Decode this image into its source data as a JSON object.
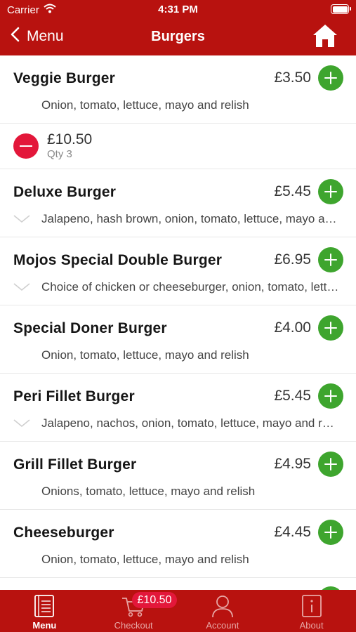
{
  "status_bar": {
    "carrier": "Carrier",
    "time": "4:31 PM"
  },
  "nav": {
    "back_label": "Menu",
    "title": "Burgers"
  },
  "items": [
    {
      "name": "Veggie Burger",
      "price": "£3.50",
      "description": "Onion, tomato, lettuce, mayo and relish"
    },
    {
      "name": "Deluxe Burger",
      "price": "£5.45",
      "description": "Jalapeno, hash brown, onion, tomato, lettuce, mayo and relish"
    },
    {
      "name": "Mojos Special Double Burger",
      "price": "£6.95",
      "description": "Choice of chicken or cheeseburger, onion, tomato, lettuce, mayo and relish"
    },
    {
      "name": "Special Doner Burger",
      "price": "£4.00",
      "description": "Onion, tomato, lettuce, mayo and relish"
    },
    {
      "name": "Peri Fillet Burger",
      "price": "£5.45",
      "description": "Jalapeno, nachos, onion, tomato, lettuce, mayo and relish"
    },
    {
      "name": "Grill Fillet Burger",
      "price": "£4.95",
      "description": "Onions, tomato, lettuce, mayo and relish"
    },
    {
      "name": "Cheeseburger",
      "price": "£4.45",
      "description": "Onion, tomato, lettuce, mayo and relish"
    }
  ],
  "cart_line": {
    "total": "£10.50",
    "qty": "Qty 3"
  },
  "tabbar": {
    "tabs": [
      {
        "label": "Menu"
      },
      {
        "label": "Checkout"
      },
      {
        "label": "Account"
      },
      {
        "label": "About"
      }
    ],
    "checkout_badge": "£10.50"
  },
  "colors": {
    "brand_red": "#b8120f",
    "add_green": "#3ea52e",
    "remove_red": "#e3173a"
  }
}
